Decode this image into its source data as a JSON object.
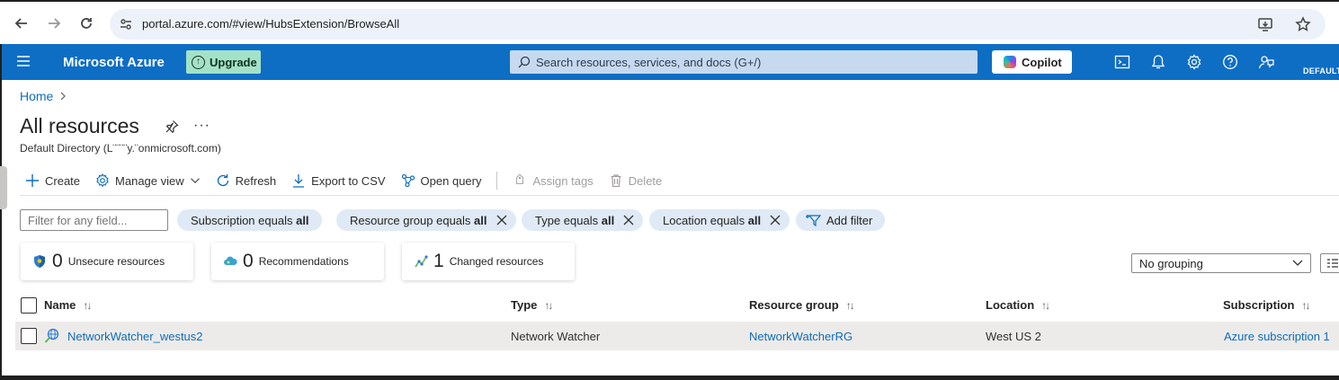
{
  "browser": {
    "url": "portal.azure.com/#view/HubsExtension/BrowseAll"
  },
  "topbar": {
    "brand": "Microsoft Azure",
    "upgrade_label": "Upgrade",
    "search_placeholder": "Search resources, services, and docs (G+/)",
    "copilot_label": "Copilot",
    "directory_label": "DEFAULT"
  },
  "breadcrumb": {
    "home": "Home"
  },
  "page": {
    "title": "All resources",
    "subtitle": "Default Directory (L¨¨¨¨y.¨onmicrosoft.com)"
  },
  "toolbar": {
    "create": "Create",
    "manage_view": "Manage view",
    "refresh": "Refresh",
    "export_csv": "Export to CSV",
    "open_query": "Open query",
    "assign_tags": "Assign tags",
    "delete": "Delete"
  },
  "filters": {
    "input_placeholder": "Filter for any field...",
    "pills": [
      {
        "label": "Subscription equals",
        "value": "all"
      },
      {
        "label": "Resource group equals",
        "value": "all"
      },
      {
        "label": "Type equals",
        "value": "all"
      },
      {
        "label": "Location equals",
        "value": "all"
      }
    ],
    "add_filter": "Add filter"
  },
  "cards": [
    {
      "count": "0",
      "label": "Unsecure resources"
    },
    {
      "count": "0",
      "label": "Recommendations"
    },
    {
      "count": "1",
      "label": "Changed resources"
    }
  ],
  "grouping": {
    "selected": "No grouping"
  },
  "table": {
    "headers": [
      "Name",
      "Type",
      "Resource group",
      "Location",
      "Subscription"
    ],
    "rows": [
      {
        "name": "NetworkWatcher_westus2",
        "type": "Network Watcher",
        "resource_group": "NetworkWatcherRG",
        "location": "West US 2",
        "subscription": "Azure subscription 1"
      }
    ]
  },
  "colors": {
    "azure_blue": "#0d6ec4",
    "link": "#0f6cbd",
    "upgrade_bg": "#a4e2c8",
    "pill_bg": "#dfeaf6"
  }
}
